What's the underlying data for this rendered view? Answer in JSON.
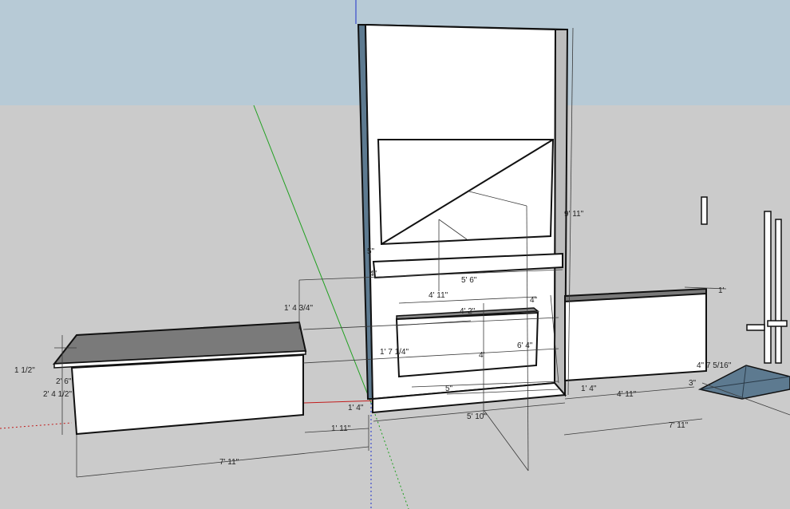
{
  "app": {
    "name": "",
    "colors": {
      "sky": "#b7cad6",
      "ground": "#cbcbcb",
      "face_white": "#ffffff",
      "face_dark": "#7a7a7a",
      "face_blue": "#5d7a90",
      "axis_red": "#c21c1c",
      "axis_green": "#1fa01f",
      "axis_blue": "#2233cc"
    }
  },
  "dimensions": {
    "wall_height": "9' 11\"",
    "shelf_width": "5' 6\"",
    "shelf_gap": "4' 11\"",
    "shelf_thickness": "5\"",
    "shelf_small": "4\"",
    "drawer_width": "4' 2\"",
    "drawer_height": "1' 7 1/4\"",
    "drawer_top": "4\"",
    "drawer_bottom": "5\"",
    "center_height": "4'",
    "total_height": "6' 4\"",
    "wall_base": "1' 4\"",
    "wall_base_width": "5' 10\"",
    "left_gap": "1' 11\"",
    "left_width": "7' 11\"",
    "left_top": "1' 4 3/4\"",
    "left_thick": "1 1/2\"",
    "left_height": "2' 6\"",
    "left_body": "2' 4 1/2\"",
    "right_depth": "1'",
    "right_small": "1' 4\"",
    "right_width": "4' 11\"",
    "right_total": "7' 11\"",
    "right_offset": "4\" 7 5/16\"",
    "right_base": "3\""
  }
}
